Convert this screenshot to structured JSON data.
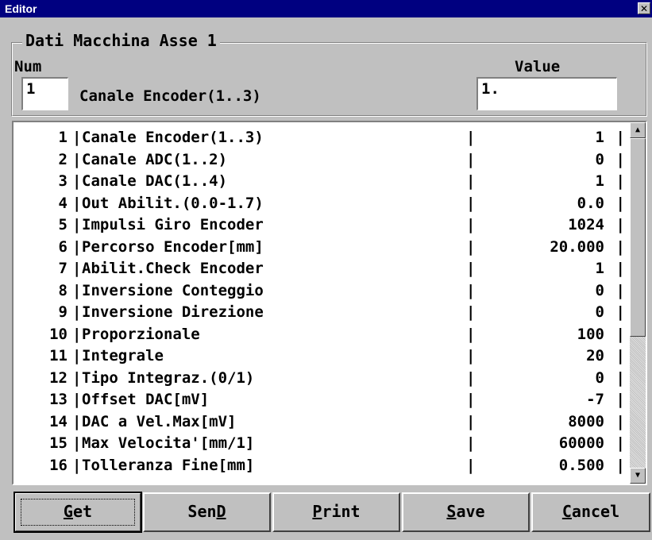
{
  "window": {
    "title": "Editor",
    "close_glyph": "✕"
  },
  "group": {
    "title": "Dati Macchina Asse 1"
  },
  "fields": {
    "num_label": "Num",
    "value_label": "Value",
    "num_value": "1",
    "name": "Canale Encoder(1..3)",
    "value_value": "1."
  },
  "list": {
    "rows": [
      {
        "num": "1",
        "name": "Canale Encoder(1..3)",
        "value": "1"
      },
      {
        "num": "2",
        "name": "Canale ADC(1..2)",
        "value": "0"
      },
      {
        "num": "3",
        "name": "Canale DAC(1..4)",
        "value": "1"
      },
      {
        "num": "4",
        "name": "Out Abilit.(0.0-1.7)",
        "value": "0.0"
      },
      {
        "num": "5",
        "name": "Impulsi Giro Encoder",
        "value": "1024"
      },
      {
        "num": "6",
        "name": "Percorso Encoder[mm]",
        "value": "20.000"
      },
      {
        "num": "7",
        "name": "Abilit.Check Encoder",
        "value": "1"
      },
      {
        "num": "8",
        "name": "Inversione Conteggio",
        "value": "0"
      },
      {
        "num": "9",
        "name": "Inversione Direzione",
        "value": "0"
      },
      {
        "num": "10",
        "name": "Proporzionale",
        "value": "100"
      },
      {
        "num": "11",
        "name": "Integrale",
        "value": "20"
      },
      {
        "num": "12",
        "name": "Tipo Integraz.(0/1)",
        "value": "0"
      },
      {
        "num": "13",
        "name": "Offset DAC[mV]",
        "value": "-7"
      },
      {
        "num": "14",
        "name": "DAC a Vel.Max[mV]",
        "value": "8000"
      },
      {
        "num": "15",
        "name": "Max Velocita'[mm/1]",
        "value": "60000"
      },
      {
        "num": "16",
        "name": "Tolleranza Fine[mm]",
        "value": "0.500"
      }
    ],
    "separator": "|",
    "scroll_up_glyph": "▲",
    "scroll_down_glyph": "▼"
  },
  "buttons": [
    {
      "id": "get",
      "label_pre": "",
      "label_key": "G",
      "label_post": "et"
    },
    {
      "id": "send",
      "label_pre": "Sen",
      "label_key": "D",
      "label_post": ""
    },
    {
      "id": "print",
      "label_pre": "",
      "label_key": "P",
      "label_post": "rint"
    },
    {
      "id": "save",
      "label_pre": "",
      "label_key": "S",
      "label_post": "ave"
    },
    {
      "id": "cancel",
      "label_pre": "",
      "label_key": "C",
      "label_post": "ancel"
    }
  ],
  "colors": {
    "titlebar": "#000080",
    "face": "#c0c0c0",
    "field": "#ffffff"
  }
}
